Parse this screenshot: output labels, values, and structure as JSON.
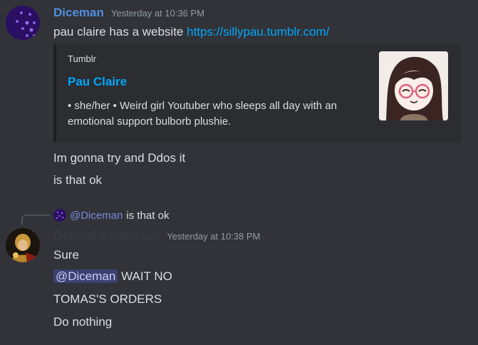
{
  "messages": [
    {
      "username": "Diceman",
      "username_color": "#4f8fe0",
      "timestamp": "Yesterday at 10:36 PM",
      "text_before_link": "pau claire has a website ",
      "link": "https://sillypau.tumblr.com/",
      "embed": {
        "provider": "Tumblr",
        "title": "Pau Claire",
        "description": "• she/her • Weird girl Youtuber who sleeps all day with an emotional support bulborb plushie."
      },
      "lines": [
        "Im gonna try and Ddos it",
        "is that ok"
      ]
    },
    {
      "reply": {
        "name": "@Diceman",
        "text": "is that ok"
      },
      "username": "General Sanguinius",
      "username_color": "#3a3d44",
      "timestamp": "Yesterday at 10:38 PM",
      "line1": "Sure",
      "mention": "@Diceman",
      "mention_text": " WAIT NO",
      "line3": "TOMAS'S ORDERS",
      "line4": "Do nothing"
    }
  ],
  "colors": {
    "background": "#313338",
    "link": "#00a8fc",
    "embed_bg": "#2b2d31"
  }
}
